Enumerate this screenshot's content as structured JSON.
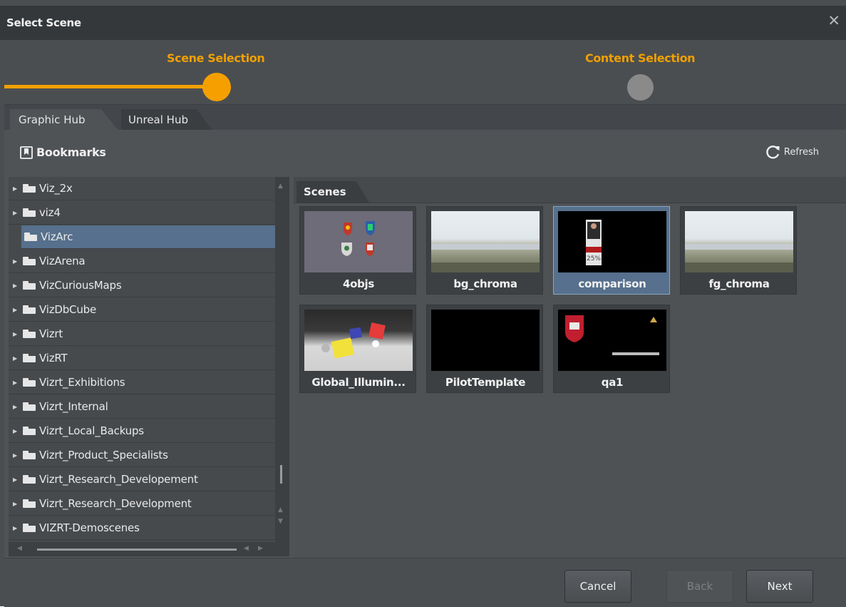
{
  "dialog": {
    "title": "Select Scene",
    "close": "✕"
  },
  "stepper": {
    "step1": "Scene Selection",
    "step2": "Content Selection",
    "current_step": 1,
    "total_steps": 2
  },
  "hub_tabs": [
    {
      "label": "Graphic Hub",
      "active": true
    },
    {
      "label": "Unreal Hub",
      "active": false
    }
  ],
  "bookmarks": {
    "title": "Bookmarks",
    "refresh": "Refresh"
  },
  "tree": {
    "items": [
      {
        "label": "Viz_2x",
        "selected": false
      },
      {
        "label": "viz4",
        "selected": false
      },
      {
        "label": "VizArc",
        "selected": true
      },
      {
        "label": "VizArena",
        "selected": false
      },
      {
        "label": "VizCuriousMaps",
        "selected": false
      },
      {
        "label": "VizDbCube",
        "selected": false
      },
      {
        "label": "Vizrt",
        "selected": false
      },
      {
        "label": "VizRT",
        "selected": false
      },
      {
        "label": "Vizrt_Exhibitions",
        "selected": false
      },
      {
        "label": "Vizrt_Internal",
        "selected": false
      },
      {
        "label": "Vizrt_Local_Backups",
        "selected": false
      },
      {
        "label": "Vizrt_Product_Specialists",
        "selected": false
      },
      {
        "label": "Vizrt_Research_Developement",
        "selected": false
      },
      {
        "label": "Vizrt_Research_Development",
        "selected": false
      },
      {
        "label": "VIZRT-Demoscenes",
        "selected": false
      }
    ]
  },
  "scenes": {
    "tab": "Scenes",
    "items": [
      {
        "label": "4objs",
        "selected": false
      },
      {
        "label": "bg_chroma",
        "selected": false
      },
      {
        "label": "comparison",
        "selected": true,
        "thumb_text": "25%"
      },
      {
        "label": "fg_chroma",
        "selected": false
      },
      {
        "label": "Global_Illumin...",
        "selected": false
      },
      {
        "label": "PilotTemplate",
        "selected": false
      },
      {
        "label": "qa1",
        "selected": false
      }
    ]
  },
  "footer": {
    "cancel": "Cancel",
    "back": "Back",
    "next": "Next"
  },
  "colors": {
    "accent": "#f5a000",
    "selection": "#56708d",
    "inactive_step": "#8a8a8a"
  }
}
